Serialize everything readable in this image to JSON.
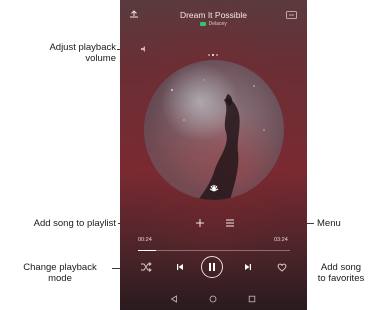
{
  "callouts": {
    "volume": "Adjust playback\nvolume",
    "playlist": "Add song to playlist",
    "menu": "Menu",
    "mode": "Change playback\nmode",
    "favorites": "Add song\nto favorites"
  },
  "player": {
    "song_title": "Dream It Possible",
    "badge_text": "Delacey",
    "time_elapsed": "00:24",
    "time_total": "03:24",
    "progress_fraction": 0.12,
    "page_indicator": {
      "count": 3,
      "active_index": 1
    }
  },
  "colors": {
    "accent_badge": "#35c46e",
    "bg_top": "#5a3a3f",
    "bg_bottom": "#2a1a1e"
  },
  "icons": {
    "top_left": "share-icon",
    "top_right": "queue-icon",
    "volume": "speaker-icon",
    "playlist": "plus-icon",
    "menu": "menu-lines-icon",
    "mode": "shuffle-icon",
    "prev": "previous-icon",
    "play_pause": "pause-icon",
    "next": "next-icon",
    "favorite": "heart-icon",
    "nav_back": "back-triangle-icon",
    "nav_home": "home-circle-icon",
    "nav_recent": "recent-square-icon"
  }
}
